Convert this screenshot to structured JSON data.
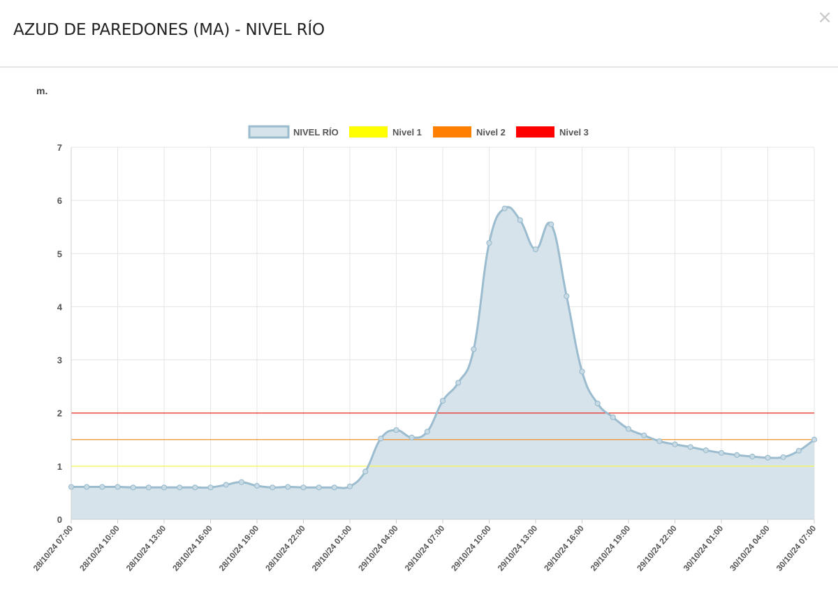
{
  "modal": {
    "title": "AZUD DE PAREDONES (MA) - NIVEL RÍO",
    "close_symbol": "×"
  },
  "chart_data": {
    "type": "area",
    "ylabel": "m.",
    "ylim": [
      0,
      7
    ],
    "yticks": [
      0,
      1,
      2,
      3,
      4,
      5,
      6,
      7
    ],
    "grid": true,
    "legend_position": "top-center",
    "x_categories": [
      "28/10/24 07:00",
      "28/10/24 08:00",
      "28/10/24 09:00",
      "28/10/24 10:00",
      "28/10/24 11:00",
      "28/10/24 12:00",
      "28/10/24 13:00",
      "28/10/24 14:00",
      "28/10/24 15:00",
      "28/10/24 16:00",
      "28/10/24 17:00",
      "28/10/24 18:00",
      "28/10/24 19:00",
      "28/10/24 20:00",
      "28/10/24 21:00",
      "28/10/24 22:00",
      "28/10/24 23:00",
      "29/10/24 00:00",
      "29/10/24 01:00",
      "29/10/24 02:00",
      "29/10/24 03:00",
      "29/10/24 04:00",
      "29/10/24 05:00",
      "29/10/24 06:00",
      "29/10/24 07:00",
      "29/10/24 08:00",
      "29/10/24 09:00",
      "29/10/24 10:00",
      "29/10/24 11:00",
      "29/10/24 12:00",
      "29/10/24 13:00",
      "29/10/24 14:00",
      "29/10/24 15:00",
      "29/10/24 16:00",
      "29/10/24 17:00",
      "29/10/24 18:00",
      "29/10/24 19:00",
      "29/10/24 20:00",
      "29/10/24 21:00",
      "29/10/24 22:00",
      "29/10/24 23:00",
      "30/10/24 00:00",
      "30/10/24 01:00",
      "30/10/24 02:00",
      "30/10/24 03:00",
      "30/10/24 04:00",
      "30/10/24 05:00",
      "30/10/24 06:00",
      "30/10/24 07:00"
    ],
    "x_tick_labels": [
      "28/10/24 07:00",
      "28/10/24 10:00",
      "28/10/24 13:00",
      "28/10/24 16:00",
      "28/10/24 19:00",
      "28/10/24 22:00",
      "29/10/24 01:00",
      "29/10/24 04:00",
      "29/10/24 07:00",
      "29/10/24 10:00",
      "29/10/24 13:00",
      "29/10/24 16:00",
      "29/10/24 19:00",
      "29/10/24 22:00",
      "30/10/24 01:00",
      "30/10/24 04:00",
      "30/10/24 07:00"
    ],
    "series": [
      {
        "name": "NIVEL RÍO",
        "color": "#9bbccf",
        "fill": "#d6e3ea",
        "values": [
          0.61,
          0.61,
          0.61,
          0.61,
          0.6,
          0.6,
          0.6,
          0.6,
          0.6,
          0.6,
          0.65,
          0.7,
          0.63,
          0.6,
          0.61,
          0.6,
          0.6,
          0.6,
          0.62,
          0.9,
          1.52,
          1.68,
          1.54,
          1.65,
          2.23,
          2.57,
          3.2,
          5.2,
          5.85,
          5.63,
          5.08,
          5.55,
          4.2,
          2.78,
          2.18,
          1.92,
          1.7,
          1.58,
          1.47,
          1.41,
          1.36,
          1.3,
          1.25,
          1.21,
          1.18,
          1.16,
          1.17,
          1.29,
          1.5
        ]
      }
    ],
    "thresholds": [
      {
        "name": "Nivel 1",
        "value": 1,
        "color": "#f7f74a",
        "legend_color": "#ffff00"
      },
      {
        "name": "Nivel 2",
        "value": 1.5,
        "color": "#f0902a",
        "legend_color": "#ff7f00"
      },
      {
        "name": "Nivel 3",
        "value": 2,
        "color": "#e8261f",
        "legend_color": "#ff0000"
      }
    ]
  }
}
